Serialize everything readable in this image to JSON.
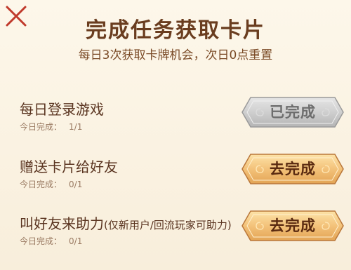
{
  "header": {
    "title": "完成任务获取卡片",
    "subtitle": "每日3次获取卡牌机会，次日0点重置"
  },
  "tasks": [
    {
      "title": "每日登录游戏",
      "note": "",
      "progress_label": "今日完成：",
      "progress_value": "1/1",
      "button_label": "已完成",
      "status": "done"
    },
    {
      "title": "赠送卡片给好友",
      "note": "",
      "progress_label": "今日完成：",
      "progress_value": "0/1",
      "button_label": "去完成",
      "status": "go"
    },
    {
      "title": "叫好友来助力",
      "note": "(仅新用户/回流玩家可助力)",
      "progress_label": "今日完成：",
      "progress_value": "0/1",
      "button_label": "去完成",
      "status": "go"
    }
  ],
  "colors": {
    "background": "#fbf3e4",
    "close_icon": "#c0392b",
    "button_gold": "#f2c27a",
    "button_grey": "#c8c8c8",
    "text_brown": "#5a3420"
  },
  "icons": {
    "close": "close-icon"
  }
}
